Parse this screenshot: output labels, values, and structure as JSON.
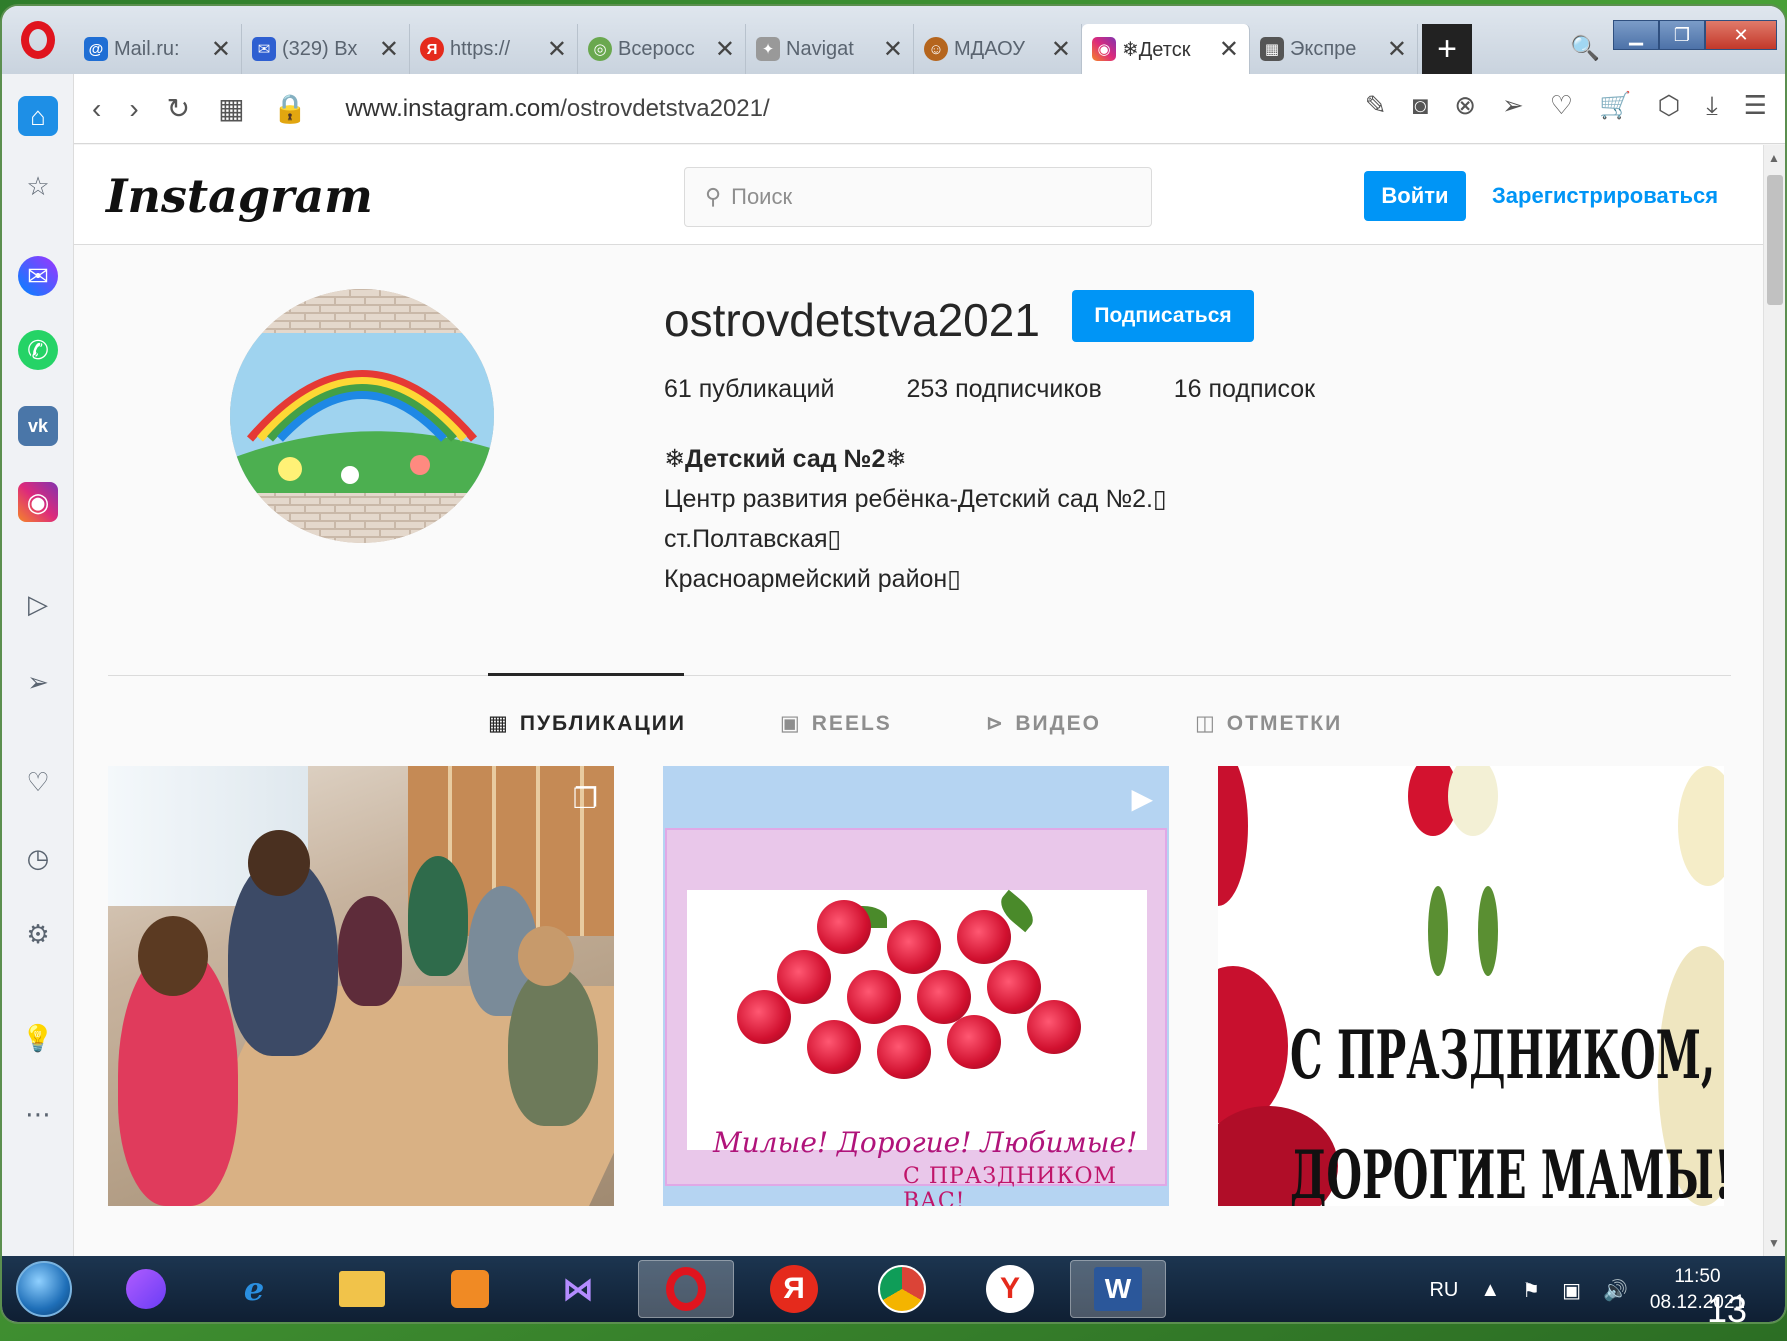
{
  "tabs": [
    {
      "title": "Mail.ru:",
      "favicon": "mailru-icon",
      "color": "#1f6ed4",
      "glyph": "@"
    },
    {
      "title": "(329) Вх",
      "favicon": "mail-envelope-icon",
      "color": "#2e5fd1",
      "glyph": "✉"
    },
    {
      "title": "https://",
      "favicon": "yandex-icon",
      "color": "#e52a1c",
      "glyph": "Я"
    },
    {
      "title": "Всеросс",
      "favicon": "globe-icon",
      "color": "#6aa84f",
      "glyph": "◎"
    },
    {
      "title": "Navigat",
      "favicon": "navigator-icon",
      "color": "#999999",
      "glyph": "✦"
    },
    {
      "title": "МДАОУ",
      "favicon": "smiley-icon",
      "color": "#b5651d",
      "glyph": "☺"
    },
    {
      "title": "❄Детск",
      "favicon": "instagram-icon",
      "color": "#d62976",
      "glyph": "◉",
      "active": true
    },
    {
      "title": "Экспре",
      "favicon": "grid-icon",
      "color": "#555555",
      "glyph": "▦"
    }
  ],
  "address": {
    "domain": "www.instagram.com",
    "path": "/ostrovdetstva2021/"
  },
  "instagram": {
    "logo": "Instagram",
    "search_placeholder": "Поиск",
    "login": "Войти",
    "register": "Зарегистрироваться",
    "username": "ostrovdetstva2021",
    "follow": "Подписаться",
    "stats": {
      "posts": "61 публикаций",
      "followers": "253 подписчиков",
      "following": "16 подписок"
    },
    "bio": {
      "name": "❄Детский сад №2❄",
      "line1": "Центр развития ребёнка-Детский сад №2.▯",
      "line2": "ст.Полтавская▯",
      "line3": "Красноармейский район▯"
    },
    "profile_tabs": [
      {
        "label": "ПУБЛИКАЦИИ",
        "icon": "grid-icon",
        "active": true
      },
      {
        "label": "REELS",
        "icon": "reels-icon"
      },
      {
        "label": "ВИДЕО",
        "icon": "play-circle-icon"
      },
      {
        "label": "ОТМЕТКИ",
        "icon": "tagged-icon"
      }
    ],
    "post2_text": {
      "script": "Милые! Дорогие! Любимые!",
      "sub": "С ПРАЗДНИКОМ ВАС!"
    },
    "post3_text": {
      "line1": "С ПРАЗДНИКОМ,",
      "line2": "ДОРОГИЕ МАМЫ!"
    }
  },
  "taskbar": {
    "lang": "RU",
    "time": "11:50",
    "date": "08.12.2021"
  },
  "slide_number": "13",
  "colors": {
    "accent": "#0095f6",
    "opera_red": "#e0141e"
  }
}
